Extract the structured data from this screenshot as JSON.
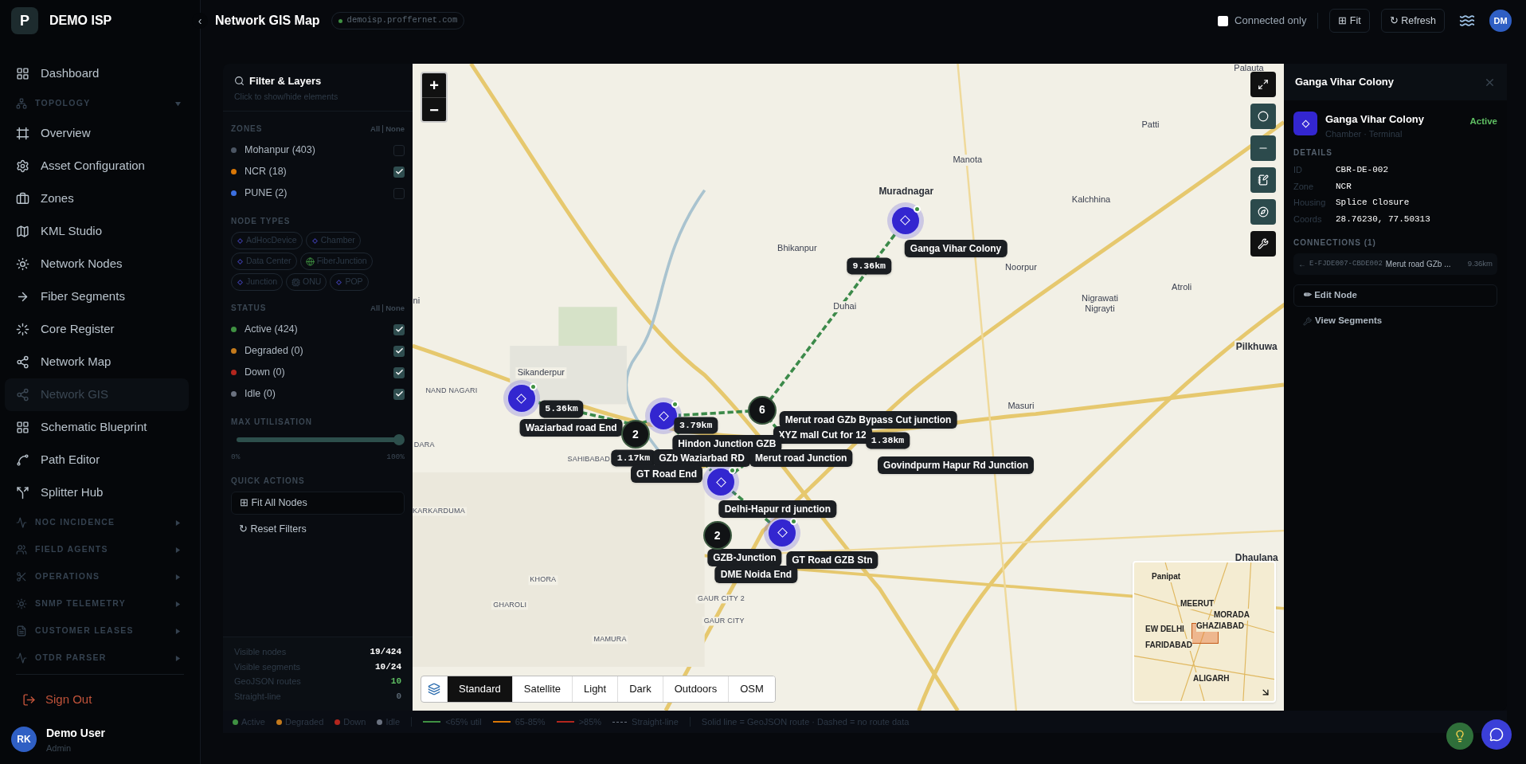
{
  "sidebar": {
    "brand_initial": "P",
    "brand": "DEMO ISP",
    "collapse": "‹",
    "items": [
      {
        "kind": "link",
        "label": "Dashboard",
        "selected": false
      },
      {
        "kind": "section",
        "label": "TOPOLOGY",
        "expanded": true
      },
      {
        "kind": "link",
        "label": "Overview",
        "selected": false
      },
      {
        "kind": "link",
        "label": "Asset Configuration",
        "selected": false
      },
      {
        "kind": "link",
        "label": "Zones",
        "selected": false
      },
      {
        "kind": "link",
        "label": "KML Studio",
        "selected": false
      },
      {
        "kind": "link",
        "label": "Network Nodes",
        "selected": false
      },
      {
        "kind": "link",
        "label": "Fiber Segments",
        "selected": false
      },
      {
        "kind": "link",
        "label": "Core Register",
        "selected": false
      },
      {
        "kind": "link",
        "label": "Network Map",
        "selected": false
      },
      {
        "kind": "link",
        "label": "Network GIS",
        "selected": true
      },
      {
        "kind": "link",
        "label": "Schematic Blueprint",
        "selected": false
      },
      {
        "kind": "link",
        "label": "Path Editor",
        "selected": false
      },
      {
        "kind": "link",
        "label": "Splitter Hub",
        "selected": false
      },
      {
        "kind": "section",
        "label": "NOC INCIDENCE",
        "expanded": false
      },
      {
        "kind": "section",
        "label": "FIELD AGENTS",
        "expanded": false
      },
      {
        "kind": "section",
        "label": "OPERATIONS",
        "expanded": false
      },
      {
        "kind": "section",
        "label": "SNMP TELEMETRY",
        "expanded": false
      },
      {
        "kind": "section",
        "label": "CUSTOMER LEASES",
        "expanded": false
      },
      {
        "kind": "section",
        "label": "OTDR PARSER",
        "expanded": false
      }
    ],
    "sign_out": "Sign Out",
    "user": {
      "initials": "RK",
      "name": "Demo User",
      "role": "Admin"
    }
  },
  "header": {
    "title": "Network GIS Map",
    "host": "demoisp.proffernet.com",
    "connected_only": {
      "label": "Connected only",
      "checked": false
    },
    "fit": "⊞ Fit",
    "refresh": "↻ Refresh",
    "avatar": "DM"
  },
  "filter": {
    "title": "Filter & Layers",
    "subtitle": "Click to show/hide elements",
    "zones": {
      "title": "ZONES",
      "all": "All",
      "none": "None",
      "items": [
        {
          "label": "Mohanpur (403)",
          "color": "#4b5563",
          "checked": false
        },
        {
          "label": "NCR (18)",
          "color": "#d97706",
          "checked": true
        },
        {
          "label": "PUNE (2)",
          "color": "#3b6fe0",
          "checked": false
        }
      ]
    },
    "node_types": {
      "title": "NODE TYPES",
      "items": [
        {
          "label": "AdHocDevice",
          "kind": "diamond"
        },
        {
          "label": "Chamber",
          "kind": "diamond"
        },
        {
          "label": "Data Center",
          "kind": "diamond"
        },
        {
          "label": "FiberJunction",
          "kind": "globe"
        },
        {
          "label": "Junction",
          "kind": "diamond"
        },
        {
          "label": "ONU",
          "kind": "chip"
        },
        {
          "label": "POP",
          "kind": "diamond"
        }
      ]
    },
    "status": {
      "title": "STATUS",
      "all": "All",
      "none": "None",
      "items": [
        {
          "label": "Active (424)",
          "color": "#3f9142",
          "checked": true
        },
        {
          "label": "Degraded (0)",
          "color": "#c47a1c",
          "checked": true
        },
        {
          "label": "Down (0)",
          "color": "#b3261e",
          "checked": true
        },
        {
          "label": "Idle (0)",
          "color": "#6b7280",
          "checked": true
        }
      ]
    },
    "max_utilisation": {
      "title": "MAX UTILISATION",
      "level": 1,
      "min": "0%",
      "max": "100%"
    },
    "quick_actions": {
      "title": "QUICK ACTIONS",
      "buttons": [
        "⊞ Fit All Nodes",
        "↻ Reset Filters"
      ]
    },
    "stats": [
      {
        "label": "Visible nodes",
        "value": "19/424",
        "kind": "count"
      },
      {
        "label": "Visible segments",
        "value": "10/24",
        "kind": "count"
      },
      {
        "label": "GeoJSON routes",
        "value": "10",
        "kind": "routes"
      },
      {
        "label": "Straight-line",
        "value": "0",
        "kind": "fallback"
      }
    ]
  },
  "map": {
    "zoom_in": "+",
    "zoom_out": "−",
    "places": [
      {
        "label": "Palauta",
        "kind": "locality"
      },
      {
        "label": "Patti",
        "kind": "locality"
      },
      {
        "label": "Manota",
        "kind": "locality"
      },
      {
        "label": "Muradnagar",
        "kind": "town"
      },
      {
        "label": "Kalchhina",
        "kind": "locality"
      },
      {
        "label": "Bhikanpur",
        "kind": "locality"
      },
      {
        "label": "Noorpur",
        "kind": "locality"
      },
      {
        "label": "Duhai",
        "kind": "locality"
      },
      {
        "label": "Atroli",
        "kind": "locality"
      },
      {
        "label": "Nigrawati Nigrayti",
        "kind": "locality"
      },
      {
        "label": "Pilkhuwa",
        "kind": "town"
      },
      {
        "label": "Masuri",
        "kind": "locality"
      },
      {
        "label": "Sikanderpur",
        "kind": "locality"
      },
      {
        "label": "NAND NAGARI",
        "kind": "district"
      },
      {
        "label": "SAHIBABAD",
        "kind": "district"
      },
      {
        "label": "KARKARDUMA",
        "kind": "district"
      },
      {
        "label": "KHORA",
        "kind": "district"
      },
      {
        "label": "GHAROLI",
        "kind": "district"
      },
      {
        "label": "GAUR CITY 2",
        "kind": "district"
      },
      {
        "label": "GAUR CITY",
        "kind": "district"
      },
      {
        "label": "MAMURA",
        "kind": "district"
      },
      {
        "label": "Dhaulana",
        "kind": "town"
      },
      {
        "label": "ni",
        "kind": "locality"
      },
      {
        "label": "DARA",
        "kind": "district"
      }
    ],
    "clusters": [
      "6",
      "2",
      "2"
    ],
    "labels": [
      {
        "text": "Ganga Vihar Colony",
        "kind": "node"
      },
      {
        "text": "9.36km",
        "kind": "distance"
      },
      {
        "text": "5.36km",
        "kind": "distance"
      },
      {
        "text": "Waziarbad road End",
        "kind": "node"
      },
      {
        "text": "3.79km",
        "kind": "distance"
      },
      {
        "text": "Merut road GZb Bypass Cut junction",
        "kind": "node"
      },
      {
        "text": "XYZ mall Cut for 12",
        "kind": "node"
      },
      {
        "text": "1.38km",
        "kind": "distance"
      },
      {
        "text": "Hindon Junction GZB",
        "kind": "node"
      },
      {
        "text": "1.17km",
        "kind": "distance"
      },
      {
        "text": "GZb Waziarbad RD",
        "kind": "node"
      },
      {
        "text": "Merut road Junction",
        "kind": "node"
      },
      {
        "text": "GT Road End",
        "kind": "node"
      },
      {
        "text": "Govindpurm Hapur Rd Junction",
        "kind": "node"
      },
      {
        "text": "Delhi-Hapur rd junction",
        "kind": "node"
      },
      {
        "text": "GZB-Junction",
        "kind": "node"
      },
      {
        "text": "GT Road GZB Stn",
        "kind": "node"
      },
      {
        "text": "DME Noida End",
        "kind": "node"
      }
    ],
    "layers": [
      {
        "label": "Standard",
        "selected": true
      },
      {
        "label": "Satellite",
        "selected": false
      },
      {
        "label": "Light",
        "selected": false
      },
      {
        "label": "Dark",
        "selected": false
      },
      {
        "label": "Outdoors",
        "selected": false
      },
      {
        "label": "OSM",
        "selected": false
      }
    ],
    "minimap": [
      "Panipat",
      "MEERUT",
      "MORADA",
      "EW DELHI",
      "GHAZIABAD",
      "FARIDABAD",
      "ALIGARH"
    ]
  },
  "details": {
    "title": "Ganga Vihar Colony",
    "node_name": "Ganga Vihar Colony",
    "node_meta": "Chamber · Terminal",
    "status": "Active",
    "details_title": "DETAILS",
    "rows": [
      {
        "label": "ID",
        "value": "CBR-DE-002"
      },
      {
        "label": "Zone",
        "value": "NCR"
      },
      {
        "label": "Housing",
        "value": "Splice Closure"
      },
      {
        "label": "Coords",
        "value": "28.76230, 77.50313"
      }
    ],
    "connections_title": "CONNECTIONS (1)",
    "connections": [
      {
        "arrow": "←",
        "id": "E-FJDE007-CBDE002",
        "name": "Merut road GZb ...",
        "distance": "9.36km"
      }
    ],
    "edit": "✏ Edit Node",
    "view_segments": "View Segments"
  },
  "legend": {
    "statuses": [
      {
        "label": "Active",
        "color": "#3f9142"
      },
      {
        "label": "Degraded",
        "color": "#c47a1c"
      },
      {
        "label": "Down",
        "color": "#b3261e"
      },
      {
        "label": "Idle",
        "color": "#6b7280"
      }
    ],
    "utilisation": [
      {
        "label": "<65% util",
        "color": "#3f9142"
      },
      {
        "label": "65-85%",
        "color": "#d97706"
      },
      {
        "label": ">85%",
        "color": "#b3261e"
      }
    ],
    "straight": "Straight-line",
    "note": "Solid line = GeoJSON route · Dashed = no route data"
  }
}
